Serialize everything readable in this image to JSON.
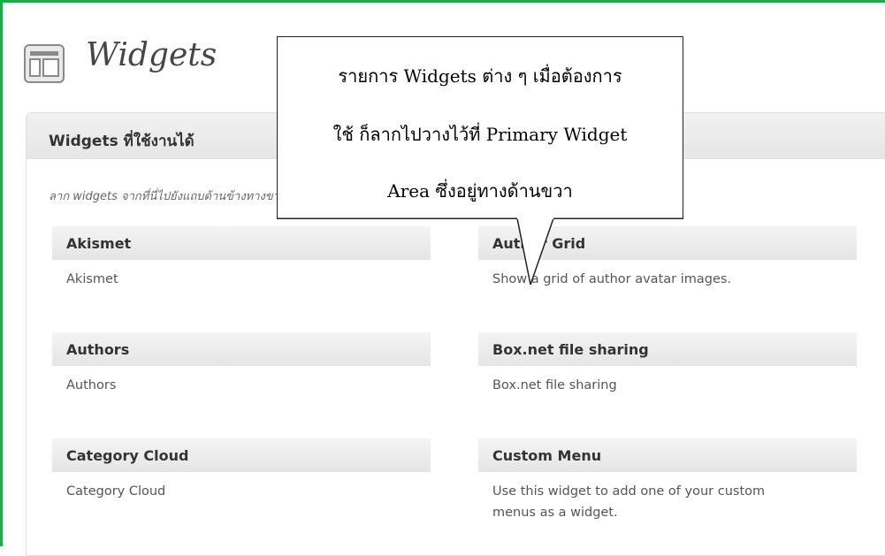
{
  "page": {
    "title": "Widgets",
    "icon": "widgets-icon",
    "frame_color": "#22a64a"
  },
  "available_widgets": {
    "title": "Widgets ที่ใช้งานได้",
    "description": "ลาก widgets จากที่นี่ไปยังแถบด้านข้างทางขวาเพื่อใช้งาน ลากกลับมาที่นี่เพื่อเลิกใช้งานแ",
    "items": [
      {
        "name": "Akismet",
        "description": "Akismet"
      },
      {
        "name": "Author Grid",
        "description": "Show a grid of author avatar images."
      },
      {
        "name": "Authors",
        "description": "Authors"
      },
      {
        "name": "Box.net file sharing",
        "description": "Box.net file sharing"
      },
      {
        "name": "Category Cloud",
        "description": "Category Cloud"
      },
      {
        "name": "Custom Menu",
        "description": "Use this widget to add one of your custom menus as a widget."
      }
    ]
  },
  "callout": {
    "line1": "รายการ Widgets ต่าง ๆ เมื่อต้องการ",
    "line2": "ใช้ ก็ลากไปวางไว้ที่ Primary Widget",
    "line3": "Area ซึ่งอยู่ทางด้านขวา"
  }
}
